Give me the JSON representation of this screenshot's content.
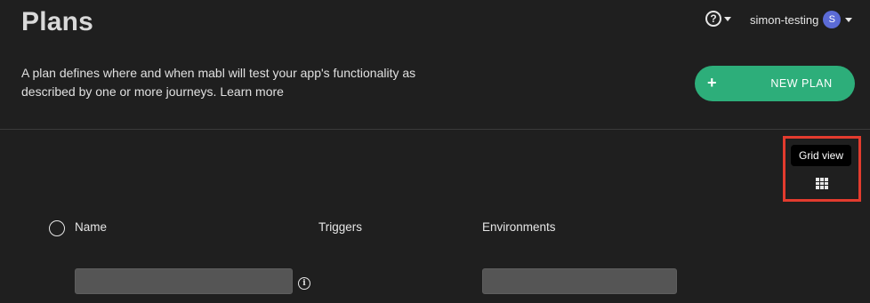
{
  "header": {
    "title": "Plans",
    "help_icon": "question-circle-icon",
    "user": {
      "name": "simon-testing",
      "avatar_initial": "S"
    }
  },
  "intro": {
    "description": "A plan defines where and when mabl will test your app's functionality as described by one or more journeys.",
    "learn_more": "Learn more"
  },
  "actions": {
    "new_plan_label": "NEW PLAN",
    "new_plan_icon": "plus-icon",
    "grid_view_tooltip": "Grid view",
    "grid_view_icon": "grid-icon",
    "accent_color": "#2dae7a",
    "highlight_color": "#e23b2e"
  },
  "table": {
    "columns": [
      "Name",
      "Triggers",
      "Environments"
    ],
    "filters": {
      "name_value": "",
      "environments_value": ""
    }
  }
}
